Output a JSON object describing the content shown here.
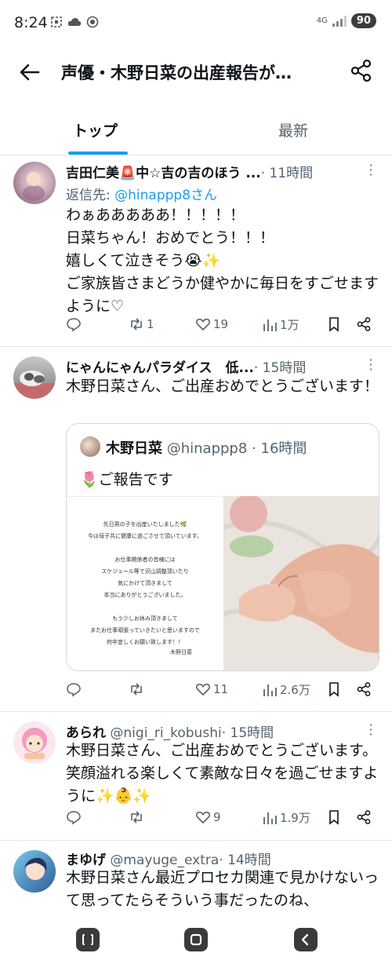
{
  "status_bar": {
    "time": "8:24",
    "left_icons": [
      "screenshot-icon",
      "cloud-icon",
      "target-icon"
    ],
    "network": "4G",
    "battery": "90"
  },
  "header": {
    "title": "声優・木野日菜の出産報告が…"
  },
  "tabs": [
    {
      "label": "トップ",
      "active": true
    },
    {
      "label": "最新",
      "active": false
    }
  ],
  "posts": [
    {
      "author": "吉田仁美🚨中☆吉の吉のほう ...",
      "handle": "",
      "time": "· 11時間",
      "reply_prefix": "返信先: ",
      "reply_handle": "@hinappp8さん",
      "text": "わぁあああああ！！！！！\n日菜ちゃん！おめでとう！！！\n嬉しくて泣きそう😭✨\nご家族皆さまどうか健やかに毎日をすごせますように♡",
      "replies": "",
      "retweets": "1",
      "likes": "19",
      "views": "1万"
    },
    {
      "author": "にゃんにゃんパラダイス　低...",
      "handle": "",
      "time": "· 15時間",
      "text": "木野日菜さん、ご出産おめでとうございます！",
      "replies": "",
      "retweets": "",
      "likes": "11",
      "views": "2.6万"
    },
    {
      "author": "あられ",
      "handle": "@nigi_ri_kobushi",
      "time": "· 15時間",
      "text": "木野日菜さん、ご出産おめでとうございます。笑顔溢れる楽しくて素敵な日々を過ごせますように✨👶✨",
      "replies": "",
      "retweets": "",
      "likes": "9",
      "views": "1.9万"
    },
    {
      "author": "まゆげ",
      "handle": "@mayuge_extra",
      "time": "· 14時間",
      "text": "木野日菜さん最近プロセカ関連で見かけないって思ってたらそういう事だったのね、"
    }
  ],
  "quote": {
    "author": "木野日菜",
    "handle": "@hinappp8",
    "time": "· 16時間",
    "text": "🌷ご報告です",
    "letter_lines": [
      "先日男の子を出産いたしました🌿",
      "今は母子共に健康に過ごさせて頂いています。",
      "",
      "お仕事関係者の皆様には",
      "スケジュール等で沢山調整頂いたり",
      "気にかけて頂きまして",
      "本当にありがとうございました。",
      "",
      "もう少しお休み頂きまして",
      "またお仕事頑張っていきたいと思いますので",
      "何卒宜しくお願い致します！！"
    ],
    "letter_signature": "木野日菜"
  },
  "colors": {
    "accent": "#1d9bf0",
    "text_secondary": "#536471",
    "separator": "#e7e7e7"
  }
}
